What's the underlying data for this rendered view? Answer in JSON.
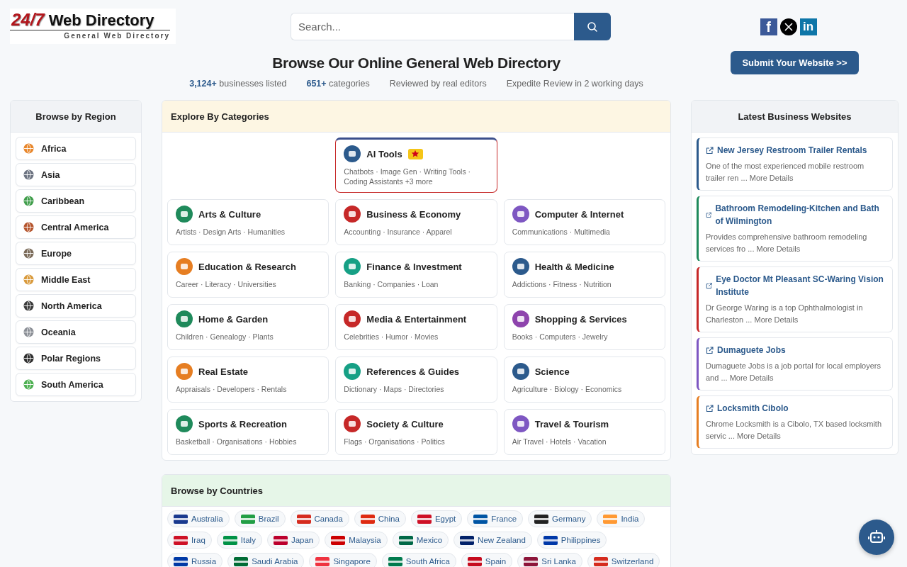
{
  "logo": {
    "mark": "24/7",
    "name": "Web Directory",
    "tagline": "General Web Directory"
  },
  "search": {
    "placeholder": "Search..."
  },
  "social": [
    {
      "kind": "facebook",
      "glyph": "f"
    },
    {
      "kind": "x"
    },
    {
      "kind": "linkedin",
      "glyph": "in"
    }
  ],
  "submit_button": "Submit Your Website >>",
  "title": "Browse Our Online General Web Directory",
  "stats": [
    "**3,124+** businesses listed",
    "**651+** categories",
    "Reviewed by real editors",
    "Expedite Review in 2 working days"
  ],
  "regions": {
    "title": "Browse by Region",
    "items": [
      {
        "label": "Africa",
        "color": "#e8862a"
      },
      {
        "label": "Asia",
        "color": "#6b7280"
      },
      {
        "label": "Caribbean",
        "color": "#3f9d4a"
      },
      {
        "label": "Central America",
        "color": "#b5542c"
      },
      {
        "label": "Europe",
        "color": "#7a6a58"
      },
      {
        "label": "Middle East",
        "color": "#d99a3c"
      },
      {
        "label": "North America",
        "color": "#3a3a3a"
      },
      {
        "label": "Oceania",
        "color": "#8b8f96"
      },
      {
        "label": "Polar Regions",
        "color": "#2f2f2f"
      },
      {
        "label": "South America",
        "color": "#4caf50"
      }
    ]
  },
  "categories": {
    "title": "Explore By Categories",
    "items": [
      {
        "title": "AI Tools",
        "featured": true,
        "color": "#2c5a8c",
        "subtitle": "Chatbots · Image Gen · Writing Tools · Coding Assistants +3 more"
      },
      {
        "title": "Arts & Culture",
        "featured": false,
        "color": "#1f8a5b",
        "subtitle": "Artists · Design Arts · Humanities"
      },
      {
        "title": "Business & Economy",
        "featured": false,
        "color": "#c62828",
        "subtitle": "Accounting · Insurance · Apparel"
      },
      {
        "title": "Computer & Internet",
        "featured": false,
        "color": "#7e57c2",
        "subtitle": "Communications · Multimedia"
      },
      {
        "title": "Education & Research",
        "featured": false,
        "color": "#e67e22",
        "subtitle": "Career · Literacy · Universities"
      },
      {
        "title": "Finance & Investment",
        "featured": false,
        "color": "#16a085",
        "subtitle": "Banking · Companies · Loan"
      },
      {
        "title": "Health & Medicine",
        "featured": false,
        "color": "#2c5a8c",
        "subtitle": "Addictions · Fitness · Nutrition"
      },
      {
        "title": "Home & Garden",
        "featured": false,
        "color": "#1f8a5b",
        "subtitle": "Children · Genealogy · Plants"
      },
      {
        "title": "Media & Entertainment",
        "featured": false,
        "color": "#c62828",
        "subtitle": "Celebrities · Humor · Movies"
      },
      {
        "title": "Shopping & Services",
        "featured": false,
        "color": "#8e44ad",
        "subtitle": "Books · Computers · Jewelry"
      },
      {
        "title": "Real Estate",
        "featured": false,
        "color": "#e67e22",
        "subtitle": "Appraisals · Developers · Rentals"
      },
      {
        "title": "References & Guides",
        "featured": false,
        "color": "#16a085",
        "subtitle": "Dictionary · Maps · Directories"
      },
      {
        "title": "Science",
        "featured": false,
        "color": "#2c5a8c",
        "subtitle": "Agriculture · Biology · Economics"
      },
      {
        "title": "Sports & Recreation",
        "featured": false,
        "color": "#1f8a5b",
        "subtitle": "Basketball · Organisations · Hobbies"
      },
      {
        "title": "Society & Culture",
        "featured": false,
        "color": "#c62828",
        "subtitle": "Flags · Organisations · Politics"
      },
      {
        "title": "Travel & Tourism",
        "featured": false,
        "color": "#7e57c2",
        "subtitle": "Air Travel · Hotels · Vacation"
      }
    ]
  },
  "countries": {
    "title": "Browse by Countries",
    "items": [
      {
        "label": "Australia",
        "color": "#1a3a8f"
      },
      {
        "label": "Brazil",
        "color": "#229e45"
      },
      {
        "label": "Canada",
        "color": "#d52b1e"
      },
      {
        "label": "China",
        "color": "#de2910"
      },
      {
        "label": "Egypt",
        "color": "#ce1126"
      },
      {
        "label": "France",
        "color": "#0055a4"
      },
      {
        "label": "Germany",
        "color": "#222222"
      },
      {
        "label": "India",
        "color": "#ff9933"
      },
      {
        "label": "Iraq",
        "color": "#ce1126"
      },
      {
        "label": "Italy",
        "color": "#009246"
      },
      {
        "label": "Japan",
        "color": "#bc002d"
      },
      {
        "label": "Malaysia",
        "color": "#cc0001"
      },
      {
        "label": "Mexico",
        "color": "#006847"
      },
      {
        "label": "New Zealand",
        "color": "#012169"
      },
      {
        "label": "Philippines",
        "color": "#0038a8"
      },
      {
        "label": "Russia",
        "color": "#0039a6"
      },
      {
        "label": "Saudi Arabia",
        "color": "#006c35"
      },
      {
        "label": "Singapore",
        "color": "#ef3340"
      },
      {
        "label": "South Africa",
        "color": "#007a4d"
      },
      {
        "label": "Spain",
        "color": "#c60b1e"
      },
      {
        "label": "Sri Lanka",
        "color": "#8d153a"
      },
      {
        "label": "Switzerland",
        "color": "#d52b1e"
      }
    ]
  },
  "latest": {
    "title": "Latest Business Websites",
    "items": [
      {
        "title": "New Jersey Restroom Trailer Rentals",
        "color": "#2c5a8c",
        "text": "One of the most experienced mobile restroom trailer ren ...",
        "link": "More Details"
      },
      {
        "title": "Bathroom Remodeling-Kitchen and Bath of Wilmington",
        "color": "#1f8a5b",
        "text": "Provides comprehensive bathroom remodeling services fro ...",
        "link": "More Details"
      },
      {
        "title": "Eye Doctor Mt Pleasant SC-Waring Vision Institute",
        "color": "#c62828",
        "text": "Dr George Waring is a top Ophthalmologist in Charleston ...",
        "link": "More Details"
      },
      {
        "title": "Dumaguete Jobs",
        "color": "#7e57c2",
        "text": "Dumaguete Jobs is a job portal for local employers and ...",
        "link": "More Details"
      },
      {
        "title": "Locksmith Cibolo",
        "color": "#e67e22",
        "text": "Chrome Locksmith is a Cibolo, TX based locksmith servic ...",
        "link": "More Details"
      }
    ]
  }
}
